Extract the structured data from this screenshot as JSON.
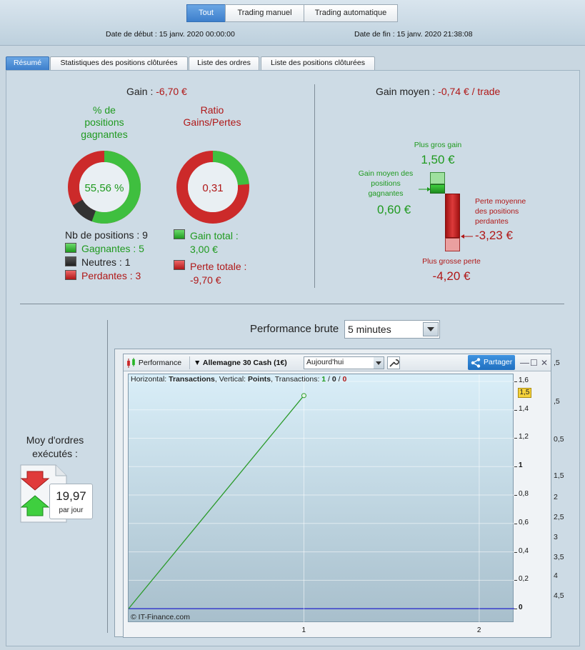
{
  "header": {
    "buttons": [
      "Tout",
      "Trading manuel",
      "Trading automatique"
    ],
    "start_date": "Date de début : 15 janv. 2020 00:00:00",
    "end_date": "Date de fin : 15 janv. 2020 21:38:08"
  },
  "tabs": [
    "Résumé",
    "Statistiques des positions clôturées",
    "Liste des ordres",
    "Liste des positions clôturées"
  ],
  "summary": {
    "gain_label": "Gain : ",
    "gain_value": "-6,70 €",
    "win_title": [
      "% de",
      "positions",
      "gagnantes"
    ],
    "win_pct": "55,56 %",
    "win_fraction": 0.5556,
    "neutral_fraction": 0.1111,
    "ratio_title": [
      "Ratio",
      "Gains/Pertes"
    ],
    "ratio_value": "0,31",
    "ratio_fraction": 0.2362,
    "nb_positions": "Nb de positions : 9",
    "gagnantes": "Gagnantes : 5",
    "neutres": "Neutres : 1",
    "perdantes": "Perdantes : 3",
    "gain_total_label": "Gain total :",
    "gain_total_value": "3,00 €",
    "perte_totale_label": "Perte totale :",
    "perte_totale_value": "-9,70 €",
    "colors": {
      "green": "#3fbf3f",
      "red": "#cc2a2a",
      "dark": "#333333"
    }
  },
  "average": {
    "label": "Gain moyen : ",
    "value": "-0,74 € / trade",
    "plus_gros_gain_label": "Plus gros gain",
    "plus_gros_gain_value": "1,50 €",
    "gain_moyen_label": [
      "Gain moyen des",
      "positions",
      "gagnantes"
    ],
    "gain_moyen_value": "0,60 €",
    "perte_moyenne_label": [
      "Perte moyenne",
      "des positions",
      "perdantes"
    ],
    "perte_moyenne_value": "-3,23 €",
    "plus_grosse_perte_label": "Plus grosse perte",
    "plus_grosse_perte_value": "-4,20 €"
  },
  "orders": {
    "label": [
      "Moy d'ordres",
      "exécutés :"
    ],
    "value": "19,97",
    "unit": "par jour"
  },
  "performance": {
    "label": "Performance brute",
    "interval": "5 minutes",
    "toolbar": {
      "performance": "Performance",
      "instrument": "Allemagne 30 Cash (1€)",
      "period": "Aujourd'hui",
      "share": "Partager"
    },
    "info": {
      "h_label": "Horizontal: ",
      "h_value": "Transactions",
      "v_label": ", Vertical: ",
      "v_value": "Points",
      "t_label": ", Transactions: ",
      "t_win": "1",
      "t_sep1": " / ",
      "t_neutral": "0",
      "t_sep2": " / ",
      "t_loss": "0"
    },
    "copyright": "© IT-Finance.com",
    "current_value_badge": "1,5"
  },
  "chart_data": {
    "type": "line",
    "x": [
      0,
      1
    ],
    "y": [
      0,
      1.5
    ],
    "xlim": [
      0,
      2.2
    ],
    "ylim": [
      -0.1,
      1.65
    ],
    "x_ticks": [
      "1",
      "2"
    ],
    "y_ticks": [
      "1,6",
      "1,4",
      "1,2",
      "1",
      "0,8",
      "0,6",
      "0,4",
      "0,2",
      "0"
    ],
    "y_tick_values": [
      1.6,
      1.4,
      1.2,
      1.0,
      0.8,
      0.6,
      0.4,
      0.2,
      0
    ],
    "grid": true,
    "line_color": "#2a9a2a",
    "zero_line_color": "#2222cc"
  },
  "background_chart_ticks": [
    ",5",
    ",5",
    "0,5",
    "1,5",
    "2",
    "2,5",
    "3",
    "3,5",
    "4",
    "4,5"
  ]
}
